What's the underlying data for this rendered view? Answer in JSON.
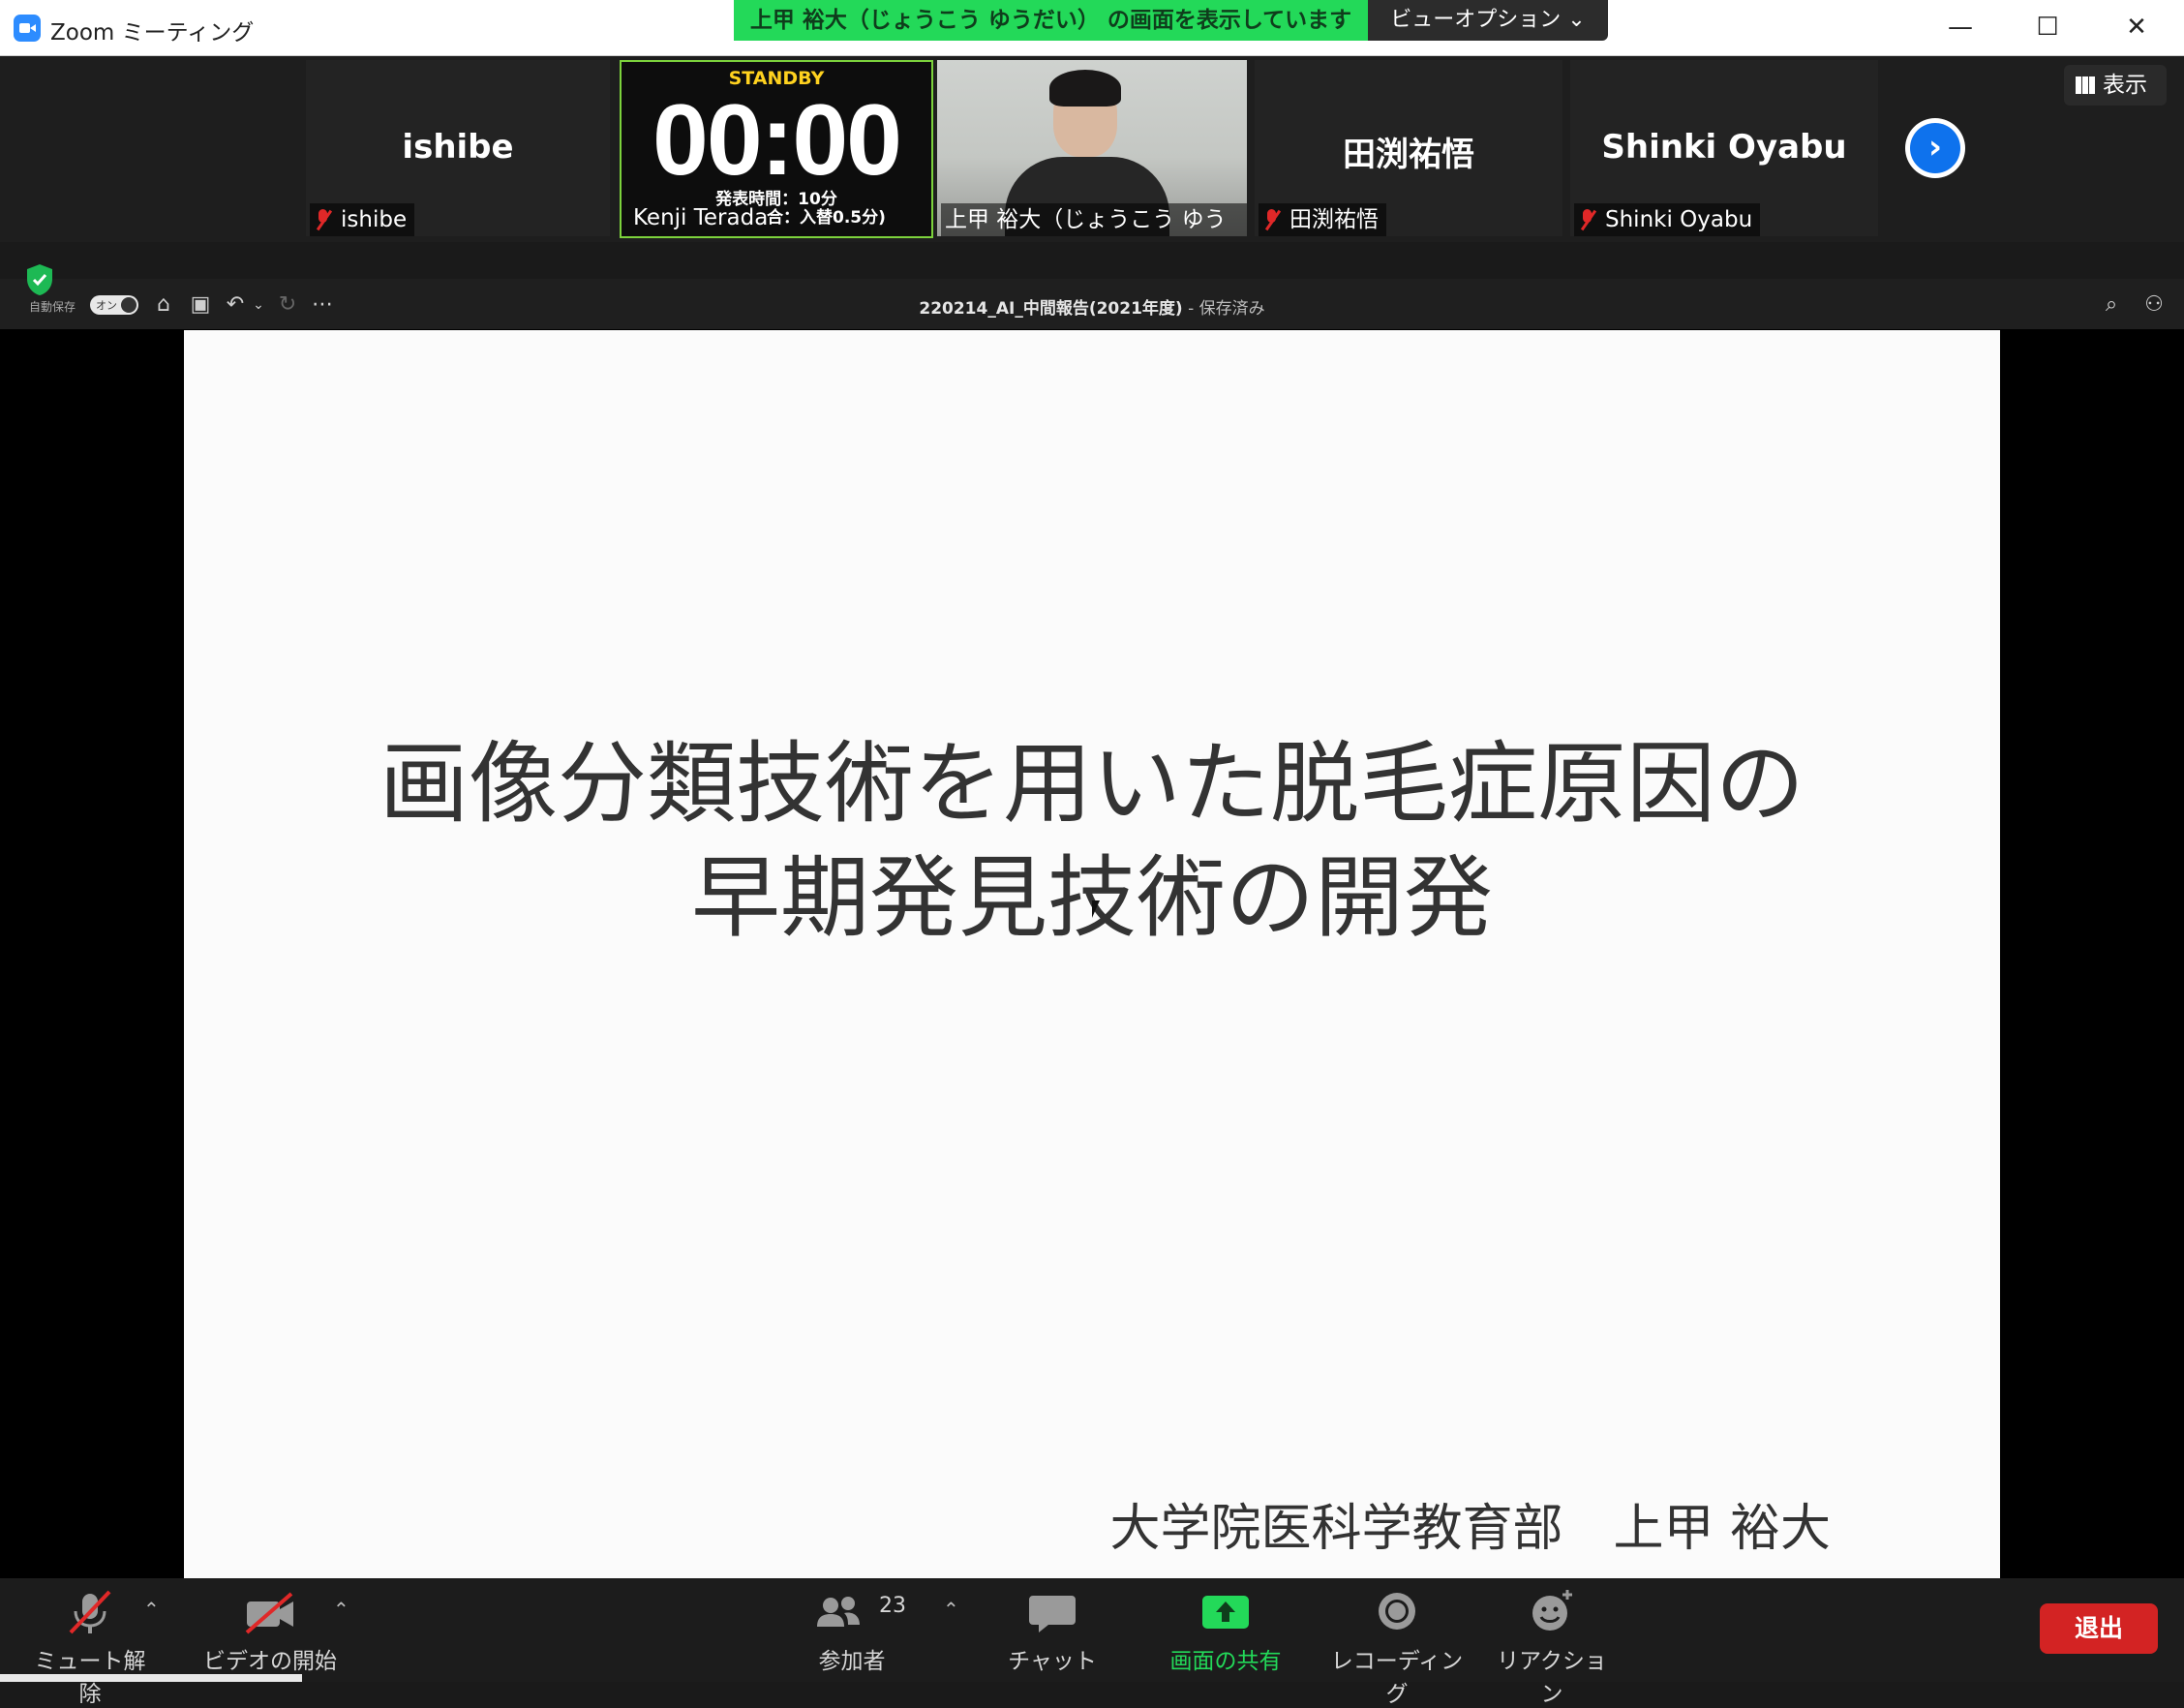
{
  "window": {
    "app_title": "Zoom ミーティング",
    "share_banner": "上甲 裕大（じょうこう ゆうだい） の画面を表示しています",
    "view_options": "ビューオプション ⌄",
    "minimize": "—",
    "maximize": "☐",
    "close": "✕"
  },
  "participants": {
    "tiles": [
      {
        "big_name": "ishibe",
        "label": "ishibe",
        "muted": true
      },
      {
        "timer": {
          "status": "STANDBY",
          "time": "00:00",
          "line1": "発表時間：10分",
          "line2": "合：入替0.5分)"
        },
        "label": "Kenji Terada"
      },
      {
        "video": true,
        "label": "上甲 裕大（じょうこう ゆうだ..."
      },
      {
        "big_name": "田渕祐悟",
        "label": "田渕祐悟",
        "muted": true
      },
      {
        "big_name": "Shinki Oyabu",
        "label": "Shinki Oyabu",
        "muted": true
      }
    ],
    "next_icon": "chevron-right-icon",
    "display_label": "表示"
  },
  "ppt": {
    "autosave_label": "自動保存",
    "toggle_text": "オン",
    "doc_title": "220214_AI_中間報告(2021年度)",
    "saved_status": " - 保存済み"
  },
  "slide": {
    "title_line1": "画像分類技術を用いた脱毛症原因の",
    "title_line2": "早期発見技術の開発",
    "author": "大学院医科学教育部　上甲 裕大"
  },
  "controls": {
    "unmute": "ミュート解除",
    "start_video": "ビデオの開始",
    "participants_label": "参加者",
    "participants_count": "23",
    "chat": "チャット",
    "share_screen": "画面の共有",
    "recording": "レコーディング",
    "reactions": "リアクション",
    "leave": "退出"
  },
  "colors": {
    "share_green": "#23d959",
    "timer_border": "#7cd23c",
    "accent_blue": "#0e72ed",
    "leave_red": "#d32323",
    "muted_red": "#e02828"
  }
}
